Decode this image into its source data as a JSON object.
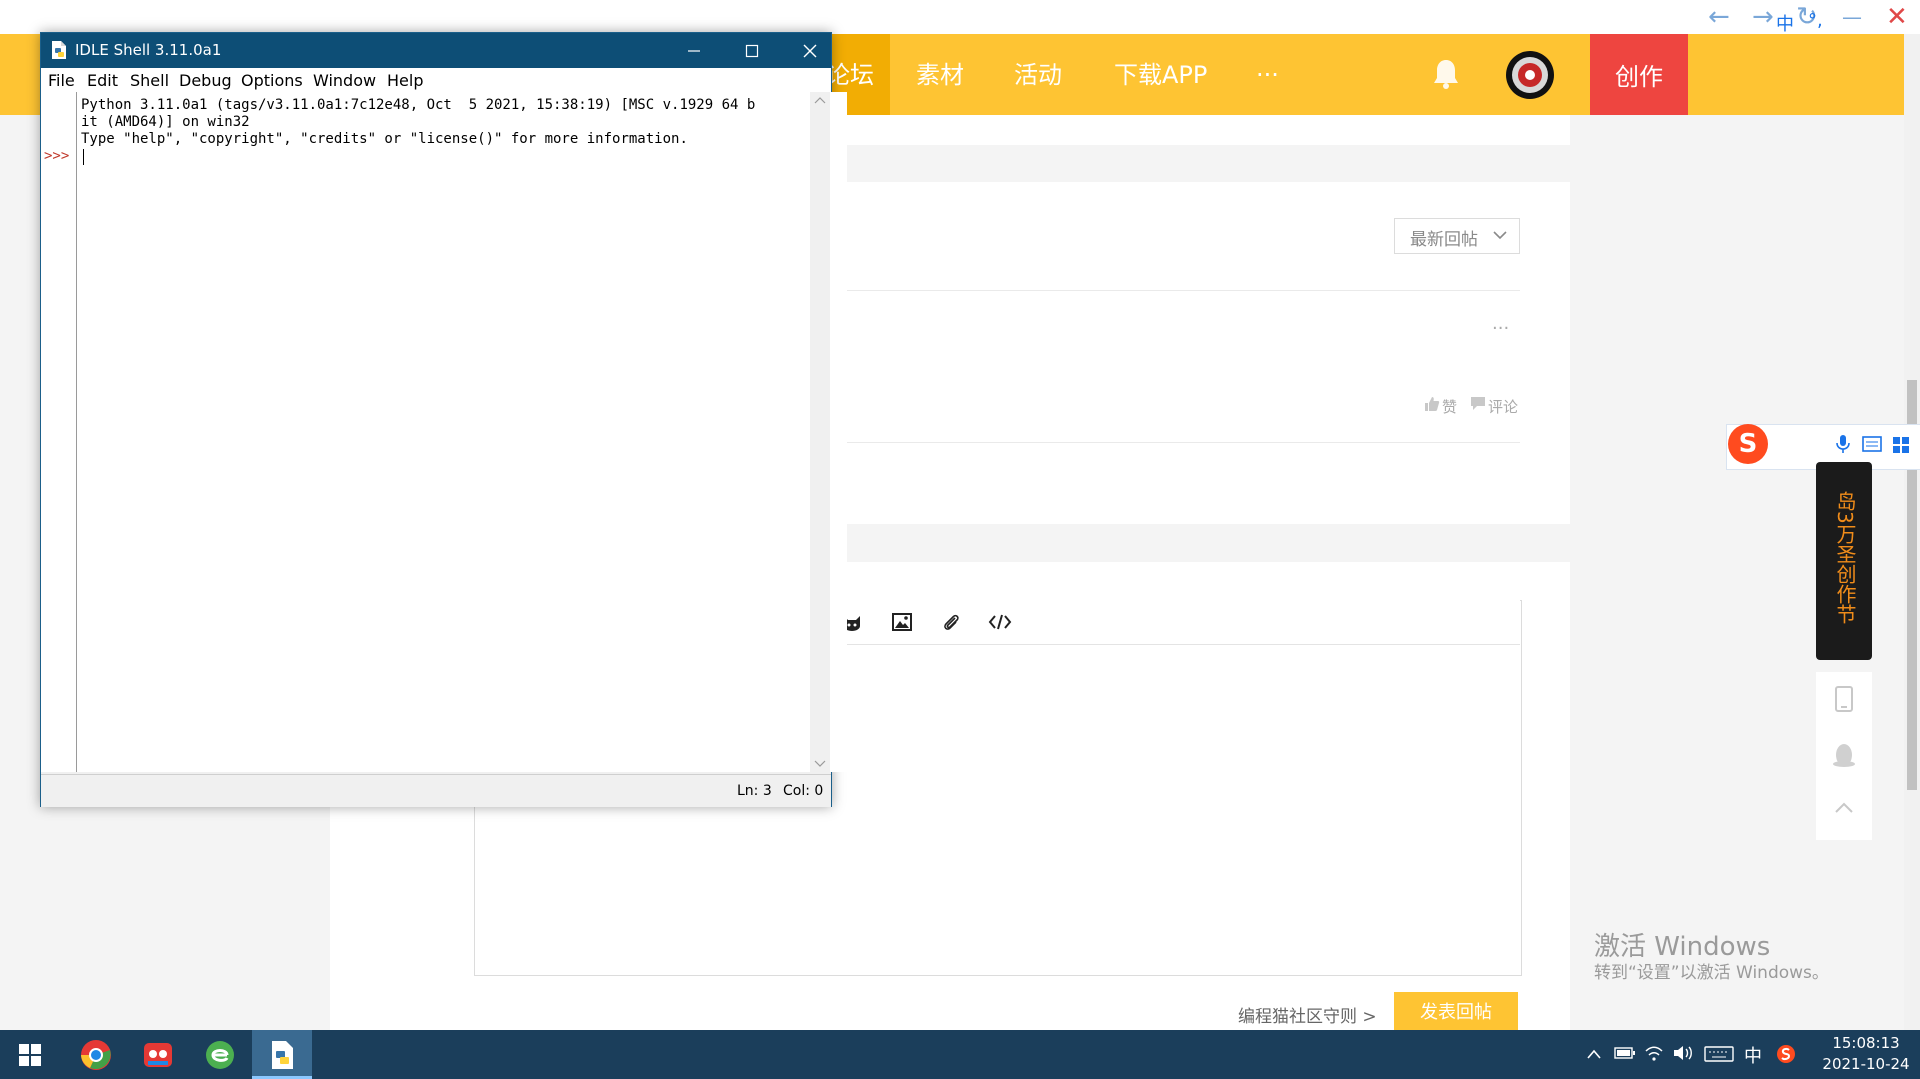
{
  "browser": {
    "back": "←",
    "forward": "→",
    "reload": "↻",
    "minimize": "—",
    "close": "✕"
  },
  "site": {
    "nav": [
      "论坛",
      "素材",
      "活动",
      "下载APP",
      "···"
    ],
    "create_label": "创作",
    "sort_select": "最新回帖",
    "more": "···",
    "like": "赞",
    "comment": "评论",
    "rules_link": "编程猫社区守则 >",
    "submit_label": "发表回帖"
  },
  "idle": {
    "title": "IDLE Shell 3.11.0a1",
    "menu": [
      "File",
      "Edit",
      "Shell",
      "Debug",
      "Options",
      "Window",
      "Help"
    ],
    "output_lines": [
      "Python 3.11.0a1 (tags/v3.11.0a1:7c12e48, Oct  5 2021, 15:38:19) [MSC v.1929 64 b",
      "it (AMD64)] on win32",
      "Type \"help\", \"copyright\", \"credits\" or \"license()\" for more information."
    ],
    "prompt": ">>>",
    "status_ln": "Ln: 3",
    "status_col": "Col: 0"
  },
  "ime": {
    "mode": "中",
    "punct": "°,",
    "logo": "S"
  },
  "side_banner": "岛3万圣创作节",
  "watermark": {
    "title": "激活 Windows",
    "subtitle": "转到“设置”以激活 Windows。"
  },
  "taskbar": {
    "tray_ime": "中",
    "time": "15:08:13",
    "date": "2021-10-24"
  },
  "colors": {
    "header": "#fec433",
    "create": "#ee4540",
    "taskbar": "#1b3e5b",
    "idle_title": "#0d4e76"
  }
}
